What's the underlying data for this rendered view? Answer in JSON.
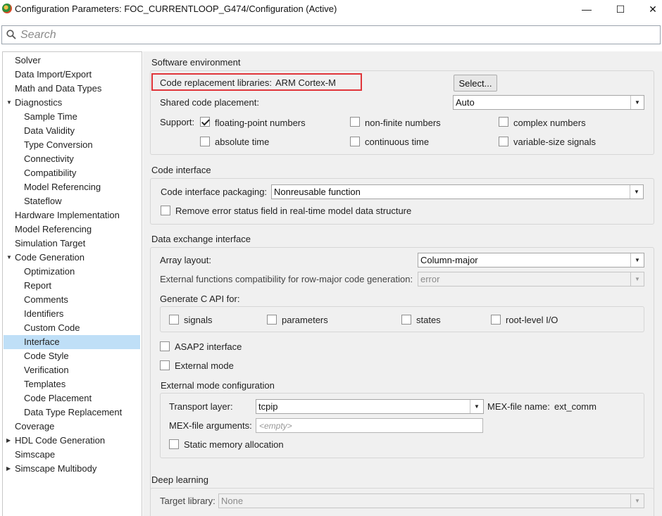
{
  "window": {
    "title": "Configuration Parameters: FOC_CURRENTLOOP_G474/Configuration (Active)",
    "minimize": "—",
    "maximize": "☐",
    "close": "✕"
  },
  "search": {
    "placeholder": "Search"
  },
  "tree": {
    "items": [
      {
        "label": "Solver"
      },
      {
        "label": "Data Import/Export"
      },
      {
        "label": "Math and Data Types"
      },
      {
        "label": "Diagnostics",
        "expanded": true
      },
      {
        "label": "Sample Time"
      },
      {
        "label": "Data Validity"
      },
      {
        "label": "Type Conversion"
      },
      {
        "label": "Connectivity"
      },
      {
        "label": "Compatibility"
      },
      {
        "label": "Model Referencing"
      },
      {
        "label": "Stateflow"
      },
      {
        "label": "Hardware Implementation"
      },
      {
        "label": "Model Referencing"
      },
      {
        "label": "Simulation Target"
      },
      {
        "label": "Code Generation",
        "expanded": true
      },
      {
        "label": "Optimization"
      },
      {
        "label": "Report"
      },
      {
        "label": "Comments"
      },
      {
        "label": "Identifiers"
      },
      {
        "label": "Custom Code"
      },
      {
        "label": "Interface",
        "selected": true
      },
      {
        "label": "Code Style"
      },
      {
        "label": "Verification"
      },
      {
        "label": "Templates"
      },
      {
        "label": "Code Placement"
      },
      {
        "label": "Data Type Replacement"
      },
      {
        "label": "Coverage"
      },
      {
        "label": "HDL Code Generation",
        "expanded": false
      },
      {
        "label": "Simscape"
      },
      {
        "label": "Simscape Multibody",
        "expanded": false
      }
    ],
    "arrow_expanded": "▼",
    "arrow_collapsed": "▶"
  },
  "software_env": {
    "title": "Software environment",
    "crl_label": "Code replacement libraries:",
    "crl_value": "ARM Cortex-M",
    "select_button": "Select...",
    "shared_label": "Shared code placement:",
    "shared_value": "Auto",
    "support_label": "Support:",
    "support": {
      "floating_point": {
        "label": "floating-point numbers",
        "checked": true
      },
      "non_finite": {
        "label": "non-finite numbers",
        "checked": false
      },
      "complex": {
        "label": "complex numbers",
        "checked": false
      },
      "absolute_time": {
        "label": "absolute time",
        "checked": false
      },
      "continuous_time": {
        "label": "continuous time",
        "checked": false
      },
      "variable_size": {
        "label": "variable-size signals",
        "checked": false
      }
    }
  },
  "code_interface": {
    "title": "Code interface",
    "packaging_label": "Code interface packaging:",
    "packaging_value": "Nonreusable function",
    "remove_error_label": "Remove error status field in real-time model data structure"
  },
  "data_exchange": {
    "title": "Data exchange interface",
    "array_layout_label": "Array layout:",
    "array_layout_value": "Column-major",
    "ext_func_label": "External functions compatibility for row-major code generation:",
    "ext_func_value": "error",
    "c_api_title": "Generate C API for:",
    "c_api": {
      "signals": "signals",
      "parameters": "parameters",
      "states": "states",
      "root_io": "root-level I/O"
    },
    "asap2_label": "ASAP2 interface",
    "external_mode_label": "External mode",
    "ext_mode_config_title": "External mode configuration",
    "transport_label": "Transport layer:",
    "transport_value": "tcpip",
    "mex_name_label": "MEX-file name:",
    "mex_name_value": "ext_comm",
    "mex_args_label": "MEX-file arguments:",
    "mex_args_placeholder": "<empty>",
    "static_mem_label": "Static memory allocation"
  },
  "deep_learning": {
    "title": "Deep learning",
    "target_label": "Target library:",
    "target_value": "None"
  },
  "colors": {
    "highlight": "#e0353a",
    "selected_row": "#bfdff7",
    "panel_bg": "#f0f0f0"
  }
}
